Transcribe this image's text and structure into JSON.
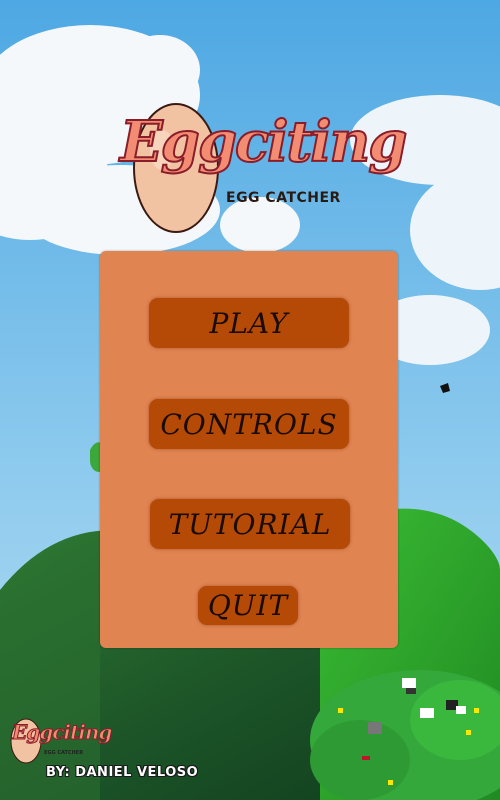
{
  "game": {
    "logo": {
      "title": "Eggciting",
      "subtitle": "EGG CATCHER"
    },
    "menu": {
      "buttons": [
        {
          "label": "PLAY"
        },
        {
          "label": "CONTROLS"
        },
        {
          "label": "TUTORIAL"
        },
        {
          "label": "QUIT"
        }
      ]
    },
    "credit": {
      "logo_title": "Eggciting",
      "logo_subtitle": "EGG CATCHER",
      "text": "BY: DANIEL VELOSO"
    }
  },
  "colors": {
    "sky": "#5fb3e6",
    "panel": "#e08452",
    "button": "#b54a06",
    "hill_dark": "#1f5a2c",
    "hill_light": "#3fbf2c"
  }
}
